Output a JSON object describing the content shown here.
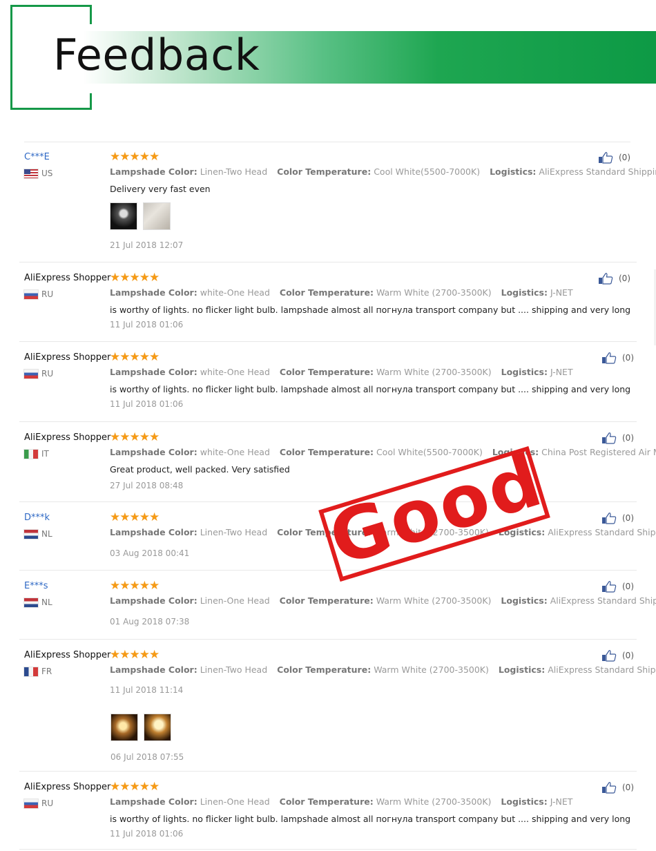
{
  "banner": {
    "title": "Feedback"
  },
  "stamp": {
    "text": "Good"
  },
  "reviews": [
    {
      "user": "C***E",
      "user_style": "masked",
      "country": "US",
      "flag": "us",
      "stars": "★★★★★",
      "lamp_label": "Lampshade Color:",
      "lamp_value": "Linen-Two Head",
      "temp_label": "Color Temperature:",
      "temp_value": "Cool White(5500-7000K)",
      "log_label": "Logistics:",
      "log_value": "AliExpress Standard Shipping",
      "text": "Delivery very fast even",
      "date": "21 Jul 2018 12:07",
      "likes": "(0)"
    },
    {
      "user": "AliExpress Shopper",
      "user_style": "shopper",
      "country": "RU",
      "flag": "ru",
      "stars": "★★★★★",
      "lamp_label": "Lampshade Color:",
      "lamp_value": "white-One Head",
      "temp_label": "Color Temperature:",
      "temp_value": "Warm White (2700-3500K)",
      "log_label": "Logistics:",
      "log_value": "J-NET",
      "text": "is worthy of lights. no flicker light bulb. lampshade almost all погнула transport company but .... shipping and very long",
      "date": "11 Jul 2018 01:06",
      "likes": "(0)"
    },
    {
      "user": "AliExpress Shopper",
      "user_style": "shopper",
      "country": "RU",
      "flag": "ru",
      "stars": "★★★★★",
      "lamp_label": "Lampshade Color:",
      "lamp_value": "white-One Head",
      "temp_label": "Color Temperature:",
      "temp_value": "Warm White (2700-3500K)",
      "log_label": "Logistics:",
      "log_value": "J-NET",
      "text": "is worthy of lights. no flicker light bulb. lampshade almost all погнула transport company but .... shipping and very long",
      "date": "11 Jul 2018 01:06",
      "likes": "(0)"
    },
    {
      "user": "AliExpress Shopper",
      "user_style": "shopper",
      "country": "IT",
      "flag": "it",
      "stars": "★★★★★",
      "lamp_label": "Lampshade Color:",
      "lamp_value": "white-One Head",
      "temp_label": "Color Temperature:",
      "temp_value": "Cool White(5500-7000K)",
      "log_label": "Logistics:",
      "log_value": "China Post Registered Air Mail",
      "text": "Great product, well packed. Very satisfied",
      "date": "27 Jul 2018 08:48",
      "likes": "(0)"
    },
    {
      "user": "D***k",
      "user_style": "masked",
      "country": "NL",
      "flag": "nl",
      "stars": "★★★★★",
      "lamp_label": "Lampshade Color:",
      "lamp_value": "Linen-Two Head",
      "temp_label": "Color Temperature:",
      "temp_value": "Warm White (2700-3500K)",
      "log_label": "Logistics:",
      "log_value": "AliExpress Standard Shipping",
      "date": "03 Aug 2018 00:41",
      "likes": "(0)"
    },
    {
      "user": "E***s",
      "user_style": "masked",
      "country": "NL",
      "flag": "nl",
      "stars": "★★★★★",
      "lamp_label": "Lampshade Color:",
      "lamp_value": "Linen-One Head",
      "temp_label": "Color Temperature:",
      "temp_value": "Warm White (2700-3500K)",
      "log_label": "Logistics:",
      "log_value": "AliExpress Standard Shipping",
      "date": "01 Aug 2018 07:38",
      "likes": "(0)"
    },
    {
      "user": "AliExpress Shopper",
      "user_style": "shopper",
      "country": "FR",
      "flag": "fr",
      "stars": "★★★★★",
      "lamp_label": "Lampshade Color:",
      "lamp_value": "Linen-Two Head",
      "temp_label": "Color Temperature:",
      "temp_value": "Warm White (2700-3500K)",
      "log_label": "Logistics:",
      "log_value": "AliExpress Standard Shipping",
      "date": "11 Jul 2018 11:14",
      "date2": "06 Jul 2018 07:55",
      "likes": "(0)"
    },
    {
      "user": "AliExpress Shopper",
      "user_style": "shopper",
      "country": "RU",
      "flag": "ru",
      "stars": "★★★★★",
      "lamp_label": "Lampshade Color:",
      "lamp_value": "Linen-One Head",
      "temp_label": "Color Temperature:",
      "temp_value": "Warm White (2700-3500K)",
      "log_label": "Logistics:",
      "log_value": "J-NET",
      "text": "is worthy of lights. no flicker light bulb. lampshade almost all погнула transport company but .... shipping and very long",
      "date": "11 Jul 2018 01:06",
      "likes": "(0)"
    }
  ]
}
